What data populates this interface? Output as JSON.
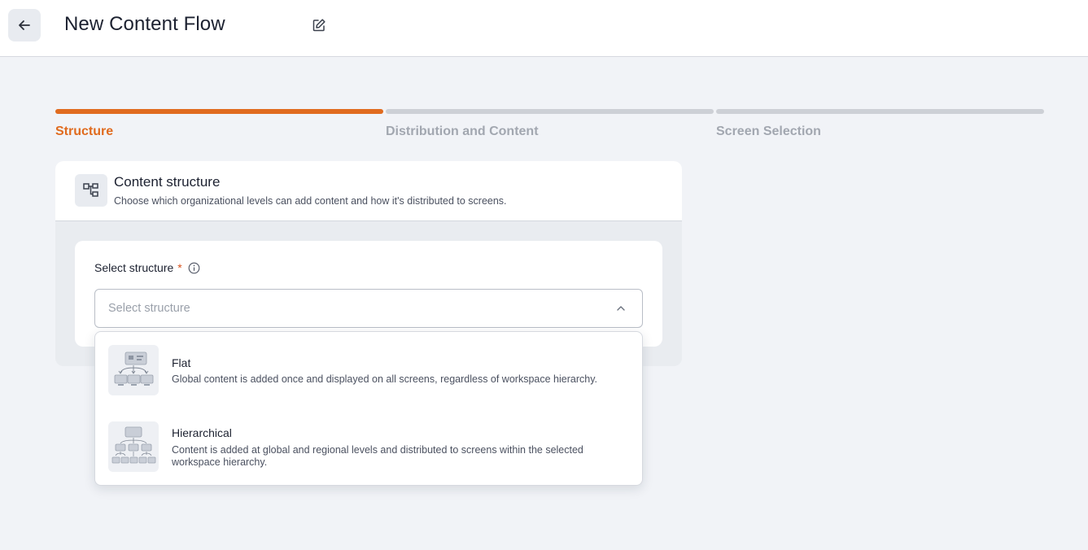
{
  "header": {
    "title": "New Content Flow",
    "back_icon": "arrow-left-icon",
    "edit_icon": "edit-icon"
  },
  "stepper": {
    "steps": [
      {
        "label": "Structure",
        "state": "active"
      },
      {
        "label": "Distribution and Content",
        "state": "inactive"
      },
      {
        "label": "Screen Selection",
        "state": "inactive"
      }
    ]
  },
  "card": {
    "icon": "structure-icon",
    "title": "Content structure",
    "subtitle": "Choose which organizational levels can add content and how it's distributed to screens."
  },
  "form": {
    "label": "Select structure",
    "required_mark": "*",
    "info_icon": "info-icon",
    "placeholder": "Select structure",
    "chevron_icon": "chevron-up-icon"
  },
  "dropdown": {
    "options": [
      {
        "title": "Flat",
        "description": "Global content is added once and displayed on all screens, regardless of workspace hierarchy.",
        "icon": "flat-structure-illustration"
      },
      {
        "title": "Hierarchical",
        "description": "Content is added at global and regional levels and distributed to screens within the selected workspace hierarchy.",
        "icon": "hierarchical-structure-illustration"
      }
    ]
  },
  "colors": {
    "accent": "#e06b1f",
    "inactive_step": "#cdd0d6",
    "background": "#f1f3f7"
  }
}
